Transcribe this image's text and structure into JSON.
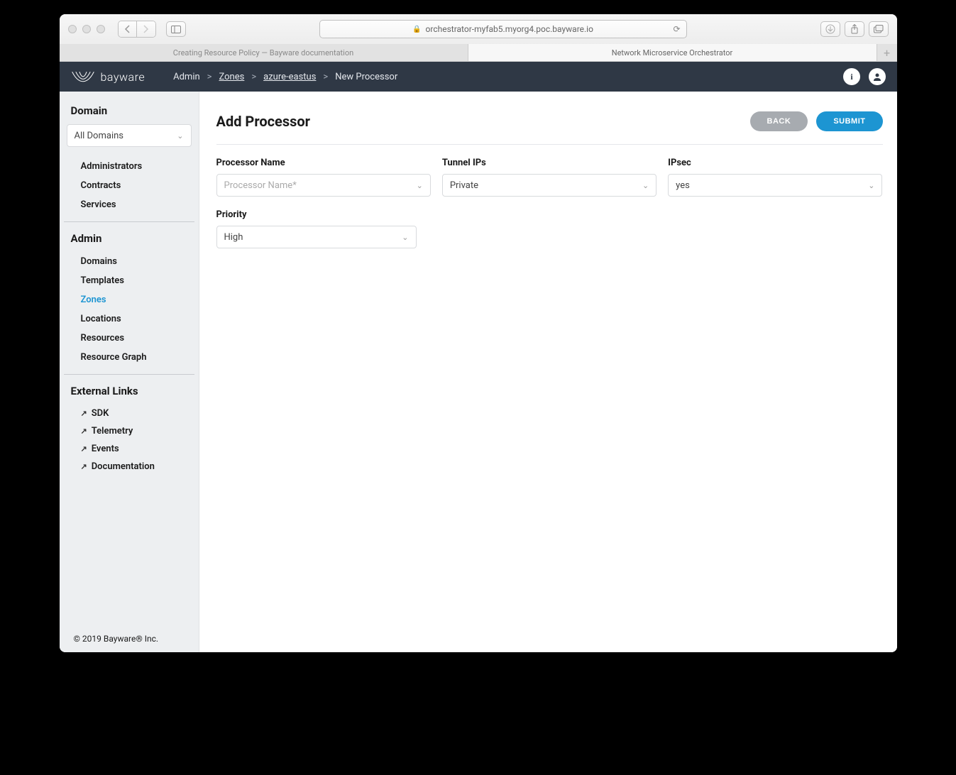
{
  "browser": {
    "url": "orchestrator-myfab5.myorg4.poc.bayware.io",
    "tabs": [
      {
        "label": "Creating Resource Policy — Bayware documentation",
        "active": false
      },
      {
        "label": "Network Microservice Orchestrator",
        "active": true
      }
    ]
  },
  "header": {
    "brand": "bayware",
    "breadcrumb": [
      {
        "label": "Admin",
        "link": false
      },
      {
        "label": "Zones",
        "link": true
      },
      {
        "label": "azure-eastus",
        "link": true
      },
      {
        "label": "New Processor",
        "link": false
      }
    ]
  },
  "sidebar": {
    "domain_title": "Domain",
    "domain_select": "All Domains",
    "domain_items": [
      {
        "label": "Administrators"
      },
      {
        "label": "Contracts"
      },
      {
        "label": "Services"
      }
    ],
    "admin_title": "Admin",
    "admin_items": [
      {
        "label": "Domains"
      },
      {
        "label": "Templates"
      },
      {
        "label": "Zones",
        "active": true
      },
      {
        "label": "Locations"
      },
      {
        "label": "Resources"
      },
      {
        "label": "Resource Graph"
      }
    ],
    "external_title": "External Links",
    "external_items": [
      {
        "label": "SDK"
      },
      {
        "label": "Telemetry"
      },
      {
        "label": "Events"
      },
      {
        "label": "Documentation"
      }
    ],
    "footer": "© 2019 Bayware® Inc."
  },
  "main": {
    "title": "Add Processor",
    "back_label": "BACK",
    "submit_label": "SUBMIT",
    "fields": {
      "processor_name": {
        "label": "Processor Name",
        "placeholder": "Processor Name*",
        "value": ""
      },
      "tunnel_ips": {
        "label": "Tunnel IPs",
        "value": "Private"
      },
      "ipsec": {
        "label": "IPsec",
        "value": "yes"
      },
      "priority": {
        "label": "Priority",
        "value": "High"
      }
    }
  }
}
